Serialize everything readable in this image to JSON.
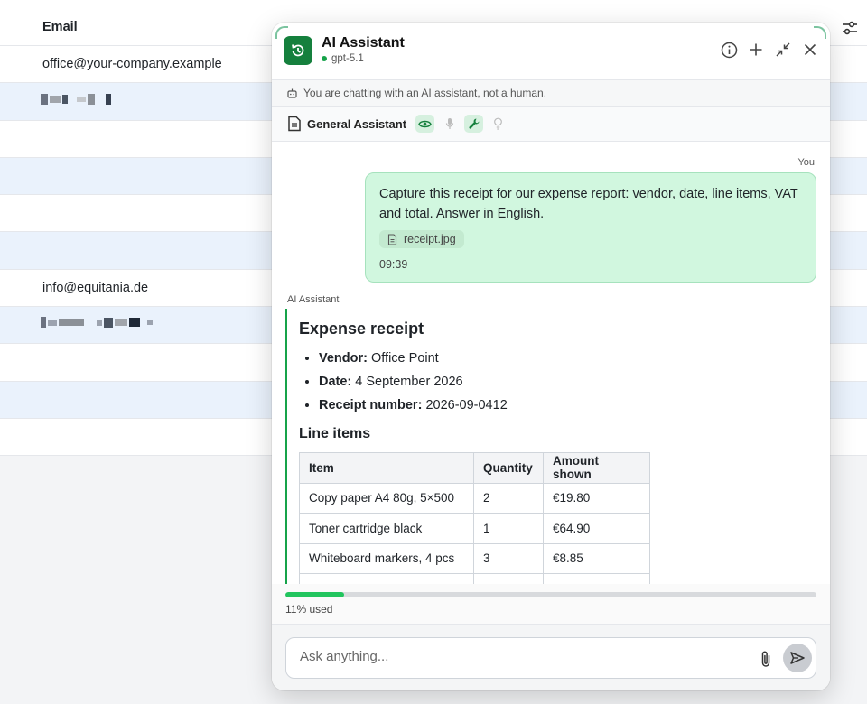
{
  "background_table": {
    "header_label": "Email",
    "rows": [
      {
        "email": "office@your-company.example",
        "alt": false
      },
      {
        "email": "",
        "alt": true
      },
      {
        "email": "",
        "alt": false
      },
      {
        "email": "",
        "alt": true
      },
      {
        "email": "",
        "alt": false
      },
      {
        "email": "",
        "alt": true
      },
      {
        "email": "info@equitania.de",
        "alt": false
      },
      {
        "email": "",
        "alt": true
      },
      {
        "email": "",
        "alt": false
      },
      {
        "email": "",
        "alt": true
      },
      {
        "email": "",
        "alt": false
      }
    ]
  },
  "panel": {
    "title": "AI Assistant",
    "model": "gpt-5.1",
    "notice": "You are chatting with an AI assistant, not a human.",
    "assistant_name": "General Assistant",
    "you_label": "You",
    "user_message": "Capture this receipt for our expense report: vendor, date, line items, VAT and total. Answer in English.",
    "attachment": "receipt.jpg",
    "time": "09:39",
    "ai_label": "AI Assistant",
    "reply": {
      "heading": "Expense receipt",
      "fields": [
        {
          "key": "Vendor:",
          "value": "Office Point"
        },
        {
          "key": "Date:",
          "value": "4 September 2026"
        },
        {
          "key": "Receipt number:",
          "value": "2026-09-0412"
        }
      ],
      "subheading": "Line items",
      "table_headers": [
        "Item",
        "Quantity",
        "Amount shown"
      ],
      "table_rows": [
        [
          "Copy paper A4 80g, 5×500",
          "2",
          "€19.80"
        ],
        [
          "Toner cartridge black",
          "1",
          "€64.90"
        ],
        [
          "Whiteboard markers, 4 pcs",
          "3",
          "€8.85"
        ]
      ]
    },
    "usage_percent": 11,
    "usage_text": "11% used",
    "input_placeholder": "Ask anything..."
  },
  "colors": {
    "accent": "#15803d",
    "bubble": "#d1f7df",
    "progress": "#22c55e"
  }
}
